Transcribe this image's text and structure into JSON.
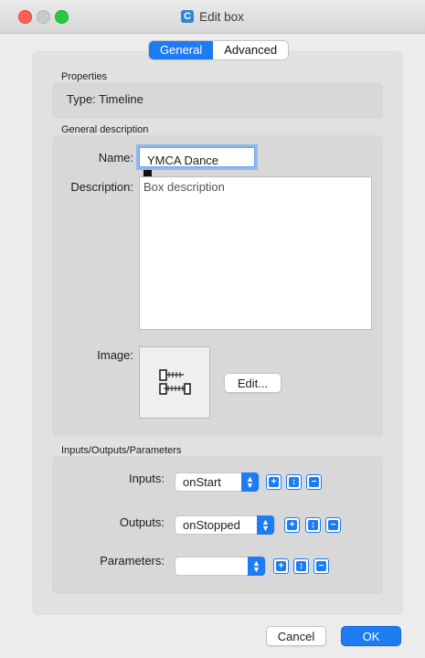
{
  "window": {
    "title": "Edit box",
    "app_icon_letter": "C"
  },
  "tabs": [
    {
      "label": "General"
    },
    {
      "label": "Advanced"
    }
  ],
  "properties": {
    "section_label": "Properties",
    "type_text": "Type: Timeline"
  },
  "general_description": {
    "section_label": "General description",
    "name_label": "Name:",
    "name_value": "YMCA Dance",
    "description_label": "Description:",
    "description_value": "Box description",
    "image_label": "Image:",
    "edit_button": "Edit..."
  },
  "io": {
    "section_label": "Inputs/Outputs/Parameters",
    "rows": [
      {
        "label": "Inputs:",
        "value": "onStart"
      },
      {
        "label": "Outputs:",
        "value": "onStopped"
      },
      {
        "label": "Parameters:",
        "value": ""
      }
    ]
  },
  "footer": {
    "cancel_label": "Cancel",
    "ok_label": "OK"
  },
  "colors": {
    "accent": "#1d7cf2",
    "close": "#fe5f57",
    "zoom": "#28c840"
  },
  "icons": {
    "add": "plus-icon",
    "edit": "edit-icon",
    "remove": "minus-icon",
    "image": "timeline-icon"
  }
}
